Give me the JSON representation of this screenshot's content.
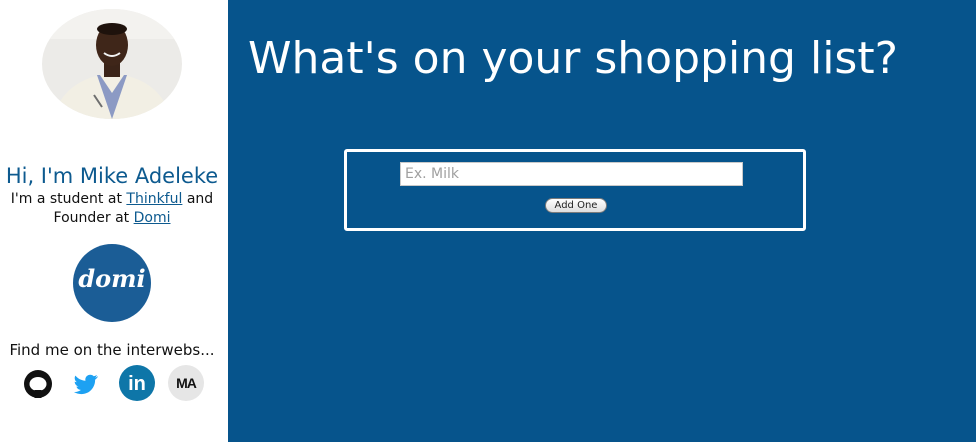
{
  "sidebar": {
    "profile_photo": "profile-photo",
    "greeting": "Hi, I'm Mike Adeleke",
    "bio": {
      "prefix": "I'm a student at ",
      "link1": "Thinkful",
      "middle": " and Founder at ",
      "link2": "Domi"
    },
    "company_logo_text": "domi",
    "find_me": "Find me on the interwebs...",
    "social": [
      {
        "name": "github",
        "icon": "github-icon"
      },
      {
        "name": "twitter",
        "icon": "twitter-icon"
      },
      {
        "name": "linkedin",
        "icon": "linkedin-icon",
        "label": "in"
      },
      {
        "name": "personal-site",
        "icon": "ma-monogram-icon",
        "label": "MA"
      }
    ]
  },
  "main": {
    "title": "What's on your shopping list?",
    "input": {
      "placeholder": "Ex. Milk",
      "value": ""
    },
    "add_button": "Add One"
  },
  "colors": {
    "main_background": "#06548c",
    "accent_text": "#0d5a8f",
    "twitter": "#1da1f2",
    "linkedin": "#0e76a8"
  }
}
